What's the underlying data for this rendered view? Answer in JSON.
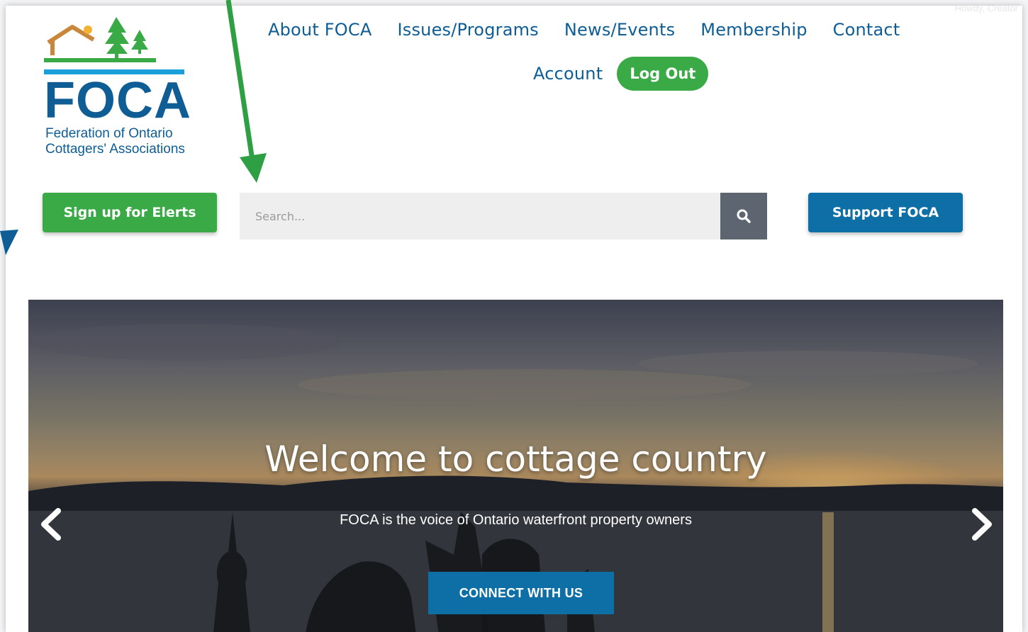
{
  "admin_bar": {
    "howdy": "Howdy, Creator"
  },
  "logo": {
    "wordmark": "FOCA",
    "tagline_line1": "Federation of Ontario",
    "tagline_line2": "Cottagers' Associations",
    "colors": {
      "house": "#c8873a",
      "trees": "#3aaa47",
      "water": "#1aa0d8",
      "text": "#0e5d95"
    }
  },
  "nav": {
    "items": [
      "About FOCA",
      "Issues/Programs",
      "News/Events",
      "Membership",
      "Contact"
    ],
    "account": "Account",
    "logout": "Log Out"
  },
  "actions": {
    "elerts": "Sign up for Elerts",
    "search_placeholder": "Search...",
    "search_icon": "search-icon",
    "support": "Support FOCA"
  },
  "hero": {
    "title": "Welcome to cottage country",
    "subtitle": "FOCA is the voice of Ontario waterfront property owners",
    "cta": "CONNECT WITH US",
    "prev_icon": "chevron-left-icon",
    "next_icon": "chevron-right-icon"
  },
  "colors": {
    "green": "#3aaa47",
    "blue": "#0e6fa6",
    "nav_text": "#0e5d95",
    "search_btn": "#5d6670"
  }
}
